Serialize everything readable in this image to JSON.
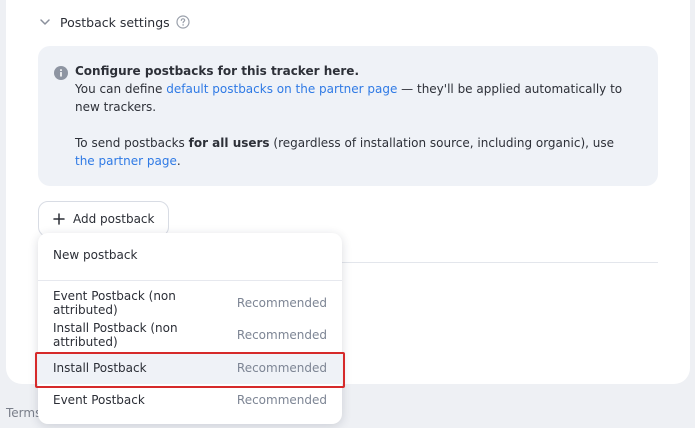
{
  "section": {
    "title": "Postback settings",
    "chevron_icon": "chevron-down-icon",
    "help_icon": "question-circle-icon"
  },
  "info": {
    "icon": "info-circle-icon",
    "line1_bold": "Configure postbacks for this tracker here.",
    "line2_prefix": "You can define ",
    "line2_link": "default postbacks on the partner page",
    "line2_suffix": " — they'll be applied automatically to new trackers.",
    "line3_prefix": "To send postbacks ",
    "line3_bold": "for all users",
    "line3_mid": " (regardless of installation source, including organic), use ",
    "line3_link": "the partner page",
    "line3_suffix": ".",
    "link_color": "#2f7ae5"
  },
  "add_button": {
    "label": "Add postback",
    "icon": "plus-icon"
  },
  "dropdown": {
    "new_item": "New postback",
    "items": [
      {
        "label": "Event Postback (non attributed)",
        "badge": "Recommended"
      },
      {
        "label": "Install Postback (non attributed)",
        "badge": "Recommended"
      },
      {
        "label": "Install Postback",
        "badge": "Recommended",
        "highlighted": true
      },
      {
        "label": "Event Postback",
        "badge": "Recommended"
      }
    ]
  },
  "footer": {
    "terms": "Terms"
  },
  "colors": {
    "annotation_red": "#d62a2a",
    "page_bg": "#eef0f4"
  }
}
